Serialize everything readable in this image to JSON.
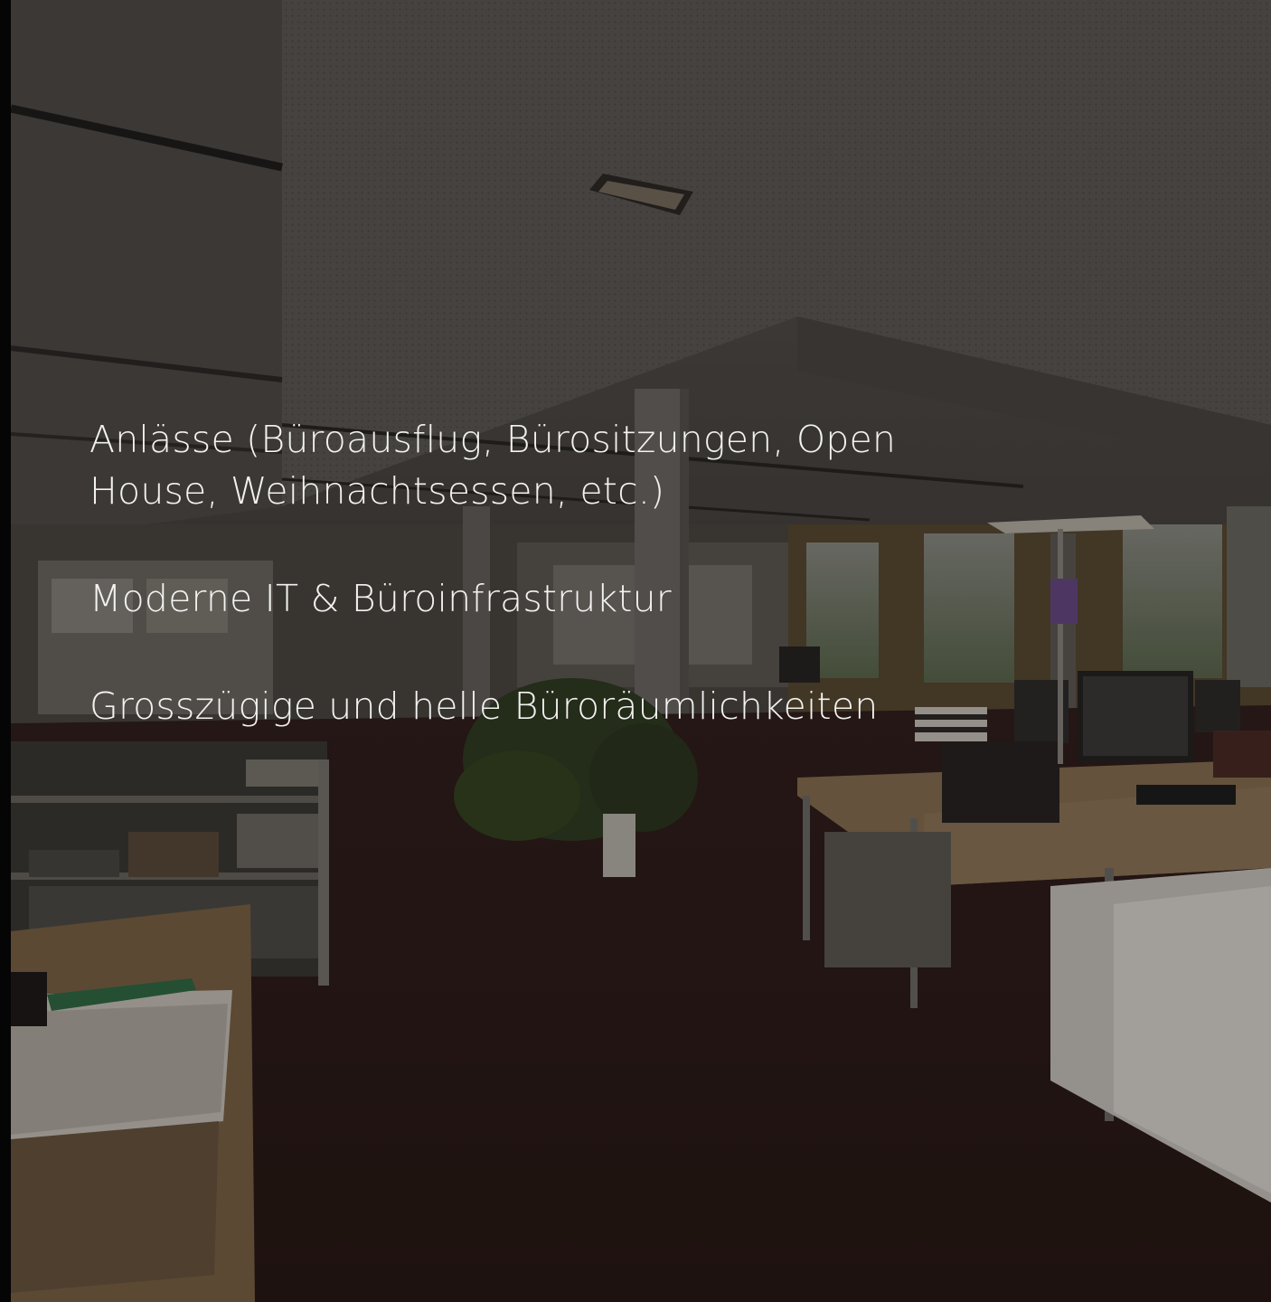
{
  "features": {
    "items": [
      {
        "text": "Anlässe (Büroausflug, Bürositzungen, Open House, Weihnachtsessen, etc.)"
      },
      {
        "text": "Moderne IT & Büroinfrastruktur"
      },
      {
        "text": "Grosszügige und helle Büroräumlichkeiten"
      }
    ]
  },
  "colors": {
    "text": "#f2f2f0",
    "overlay": "#0c0b0a",
    "carpet": "#2c1a17",
    "ceiling": "#5a5652"
  }
}
